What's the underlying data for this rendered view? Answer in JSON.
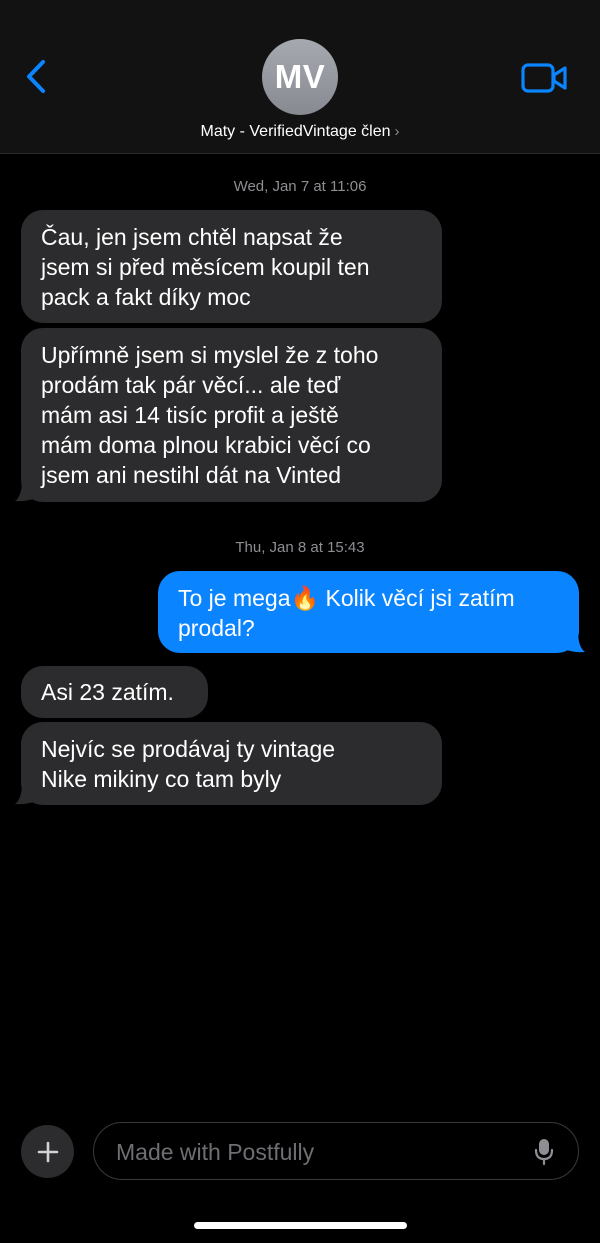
{
  "header": {
    "avatar_initials": "MV",
    "contact_name": "Maty - VerifiedVintage člen",
    "chevron": "›",
    "icons": {
      "back": "chevron-left-icon",
      "video": "video-camera-icon"
    },
    "accent_color": "#0a84ff"
  },
  "thread": {
    "timestamps": [
      "Wed, Jan 7 at 11:06",
      "Thu, Jan 8 at 15:43"
    ],
    "messages": [
      {
        "direction": "incoming",
        "lines": [
          "Čau, jen jsem chtěl napsat že",
          "jsem si před měsícem koupil ten",
          "pack a fakt díky moc"
        ]
      },
      {
        "direction": "incoming",
        "lines": [
          "Upřímně jsem si myslel že z toho",
          "prodám tak pár věcí... ale teď",
          "mám asi 14 tisíc profit a ještě",
          "mám doma plnou krabici věcí co",
          "jsem ani nestihl dát na Vinted"
        ]
      },
      {
        "direction": "outgoing",
        "lines": [
          "To je mega🔥 Kolik věcí jsi zatím",
          "prodal?"
        ]
      },
      {
        "direction": "incoming",
        "lines": [
          "Asi 23 zatím."
        ]
      },
      {
        "direction": "incoming",
        "lines": [
          "Nejvíc se prodávaj ty vintage",
          "Nike mikiny co tam byly"
        ]
      }
    ],
    "colors": {
      "incoming_bubble": "#2c2c2e",
      "outgoing_bubble": "#0a84ff"
    }
  },
  "composer": {
    "placeholder": "Made with Postfully",
    "value": "",
    "icons": {
      "add": "plus-icon",
      "mic": "microphone-icon"
    }
  }
}
